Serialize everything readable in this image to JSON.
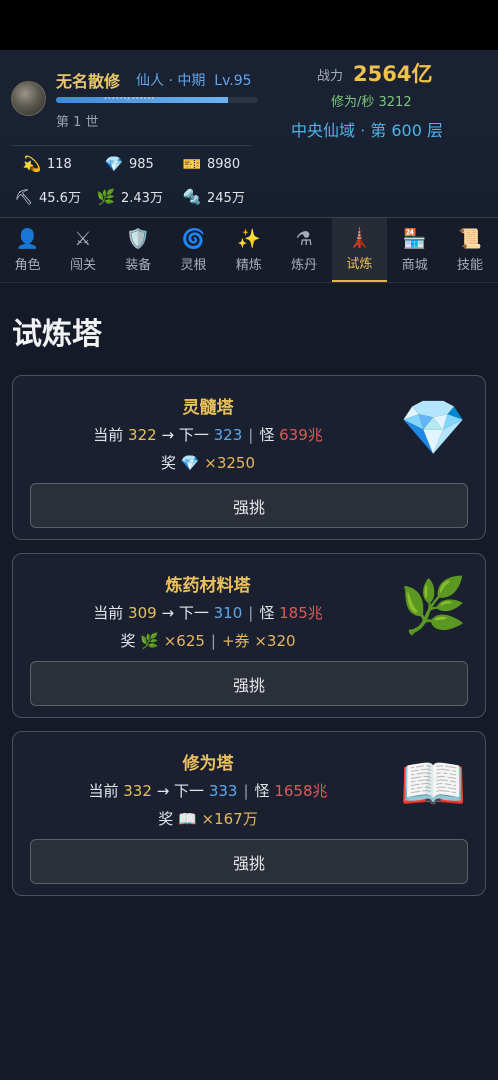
{
  "player": {
    "name": "无名散修",
    "realm": "仙人 · 中期",
    "level": "Lv.95",
    "xp_text": "XXX/XXX",
    "xp_fraction": 0.85,
    "life": "第 1 世"
  },
  "stats": {
    "power_label": "战力",
    "power_value": "2564亿",
    "rate": "修为/秒 3212",
    "location": "中央仙域 · 第 600 层"
  },
  "resources": [
    {
      "icon": "shooting-star-icon",
      "glyph": "💫",
      "value": "118"
    },
    {
      "icon": "diamond-icon",
      "glyph": "💎",
      "value": "985"
    },
    {
      "icon": "ticket-icon",
      "glyph": "🎫",
      "value": "8980"
    },
    {
      "icon": "pickaxe-icon",
      "glyph": "⛏",
      "value": "45.6万"
    },
    {
      "icon": "herb-icon",
      "glyph": "🌿",
      "value": "2.43万"
    },
    {
      "icon": "nut-bolt-icon",
      "glyph": "🔩",
      "value": "245万"
    }
  ],
  "nav": {
    "active": 6,
    "tabs": [
      {
        "label": "角色",
        "glyph": "👤",
        "icon": "person-icon"
      },
      {
        "label": "闯关",
        "glyph": "⚔",
        "icon": "crossed-swords-icon"
      },
      {
        "label": "装备",
        "glyph": "🛡️",
        "icon": "shield-icon"
      },
      {
        "label": "灵根",
        "glyph": "🌀",
        "icon": "swirl-icon"
      },
      {
        "label": "精炼",
        "glyph": "✨",
        "icon": "sparkles-icon"
      },
      {
        "label": "炼丹",
        "glyph": "⚗",
        "icon": "alembic-icon"
      },
      {
        "label": "试炼",
        "glyph": "🗼",
        "icon": "tower-icon"
      },
      {
        "label": "商城",
        "glyph": "🏪",
        "icon": "store-icon"
      },
      {
        "label": "技能",
        "glyph": "📜",
        "icon": "scroll-icon"
      }
    ]
  },
  "page": {
    "title": "试炼塔"
  },
  "towers": [
    {
      "name": "灵髓塔",
      "current_label": "当前",
      "current": "322",
      "next_label": "下一",
      "next": "323",
      "monster_label": "怪",
      "monster": "639兆",
      "reward_label": "奖",
      "reward_glyph": "💎",
      "reward_icon": "diamond-icon",
      "reward_amount": "×3250",
      "extra_label": "",
      "extra_amount": "",
      "icon": "diamond-icon",
      "glyph": "💎",
      "button": "强挑"
    },
    {
      "name": "炼药材料塔",
      "current_label": "当前",
      "current": "309",
      "next_label": "下一",
      "next": "310",
      "monster_label": "怪",
      "monster": "185兆",
      "reward_label": "奖",
      "reward_glyph": "🌿",
      "reward_icon": "herb-icon",
      "reward_amount": "×625",
      "extra_label": "+券",
      "extra_amount": "×320",
      "icon": "herb-icon",
      "glyph": "🌿",
      "button": "强挑"
    },
    {
      "name": "修为塔",
      "current_label": "当前",
      "current": "332",
      "next_label": "下一",
      "next": "333",
      "monster_label": "怪",
      "monster": "1658兆",
      "reward_label": "奖",
      "reward_glyph": "📖",
      "reward_icon": "open-book-icon",
      "reward_amount": "×167万",
      "extra_label": "",
      "extra_amount": "",
      "icon": "open-book-icon",
      "glyph": "📖",
      "button": "强挑"
    }
  ],
  "colors": {
    "gold": "#e9c05c",
    "blue": "#5ea9ec",
    "red": "#e05a55",
    "green": "#7cc67a",
    "background": "#141a28"
  }
}
